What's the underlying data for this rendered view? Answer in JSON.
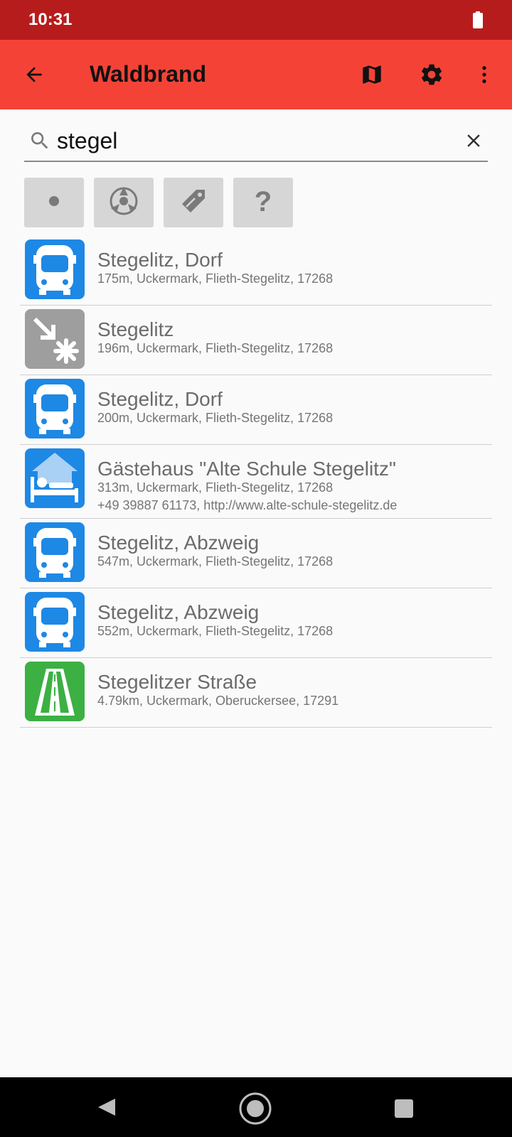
{
  "status_bar": {
    "time": "10:31",
    "battery_icon": "battery-full-icon"
  },
  "app_bar": {
    "title": "Waldbrand",
    "icons": [
      "back-arrow-icon",
      "map-icon",
      "gear-icon",
      "more-vert-icon"
    ],
    "color": "#f44336"
  },
  "search": {
    "value": "stegel",
    "icons": [
      "search-icon",
      "close-icon"
    ]
  },
  "filters": [
    "dot-icon",
    "poi-category-icon",
    "tag-icon",
    "question-icon"
  ],
  "results": [
    {
      "title": "Stegelitz, Dorf",
      "line1": "175m, Uckermark, Flieth-Stegelitz, 17268",
      "icon": "bus-stop-icon",
      "color": "#1e88e5"
    },
    {
      "title": "Stegelitz",
      "line1": "196m, Uckermark, Flieth-Stegelitz, 17268",
      "icon": "village-icon",
      "color": "#9e9e9e"
    },
    {
      "title": "Stegelitz, Dorf",
      "line1": "200m, Uckermark, Flieth-Stegelitz, 17268",
      "icon": "bus-stop-icon",
      "color": "#1e88e5"
    },
    {
      "title": "Gästehaus \"Alte Schule Stegelitz\"",
      "line1": "313m, Uckermark, Flieth-Stegelitz, 17268",
      "line2": "+49 39887 61173, http://www.alte-schule-stegelitz.de",
      "icon": "guest-house-icon",
      "color": "#1e88e5"
    },
    {
      "title": "Stegelitz, Abzweig",
      "line1": "547m, Uckermark, Flieth-Stegelitz, 17268",
      "icon": "bus-stop-icon",
      "color": "#1e88e5"
    },
    {
      "title": "Stegelitz, Abzweig",
      "line1": "552m, Uckermark, Flieth-Stegelitz, 17268",
      "icon": "bus-stop-icon",
      "color": "#1e88e5"
    },
    {
      "title": "Stegelitzer Straße",
      "line1": "4.79km, Uckermark, Oberuckersee, 17291",
      "icon": "road-icon",
      "color": "#3cb043"
    }
  ],
  "nav_bar": {
    "icons": [
      "back-triangle-icon",
      "home-circle-icon",
      "recents-square-icon"
    ]
  }
}
